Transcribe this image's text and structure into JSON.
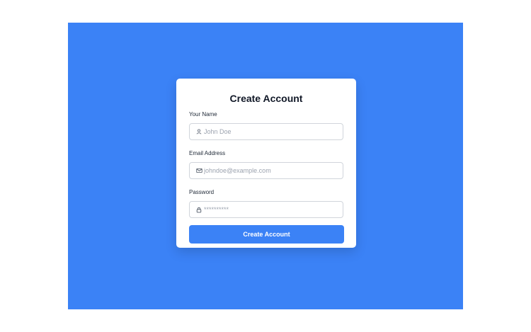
{
  "form": {
    "title": "Create Account",
    "fields": [
      {
        "label": "Your Name",
        "placeholder": "John Doe",
        "icon": "user-icon"
      },
      {
        "label": "Email Address",
        "placeholder": "johndoe@example.com",
        "icon": "mail-icon"
      },
      {
        "label": "Password",
        "placeholder": "**********",
        "icon": "lock-icon"
      }
    ],
    "submit_label": "Create Account"
  },
  "colors": {
    "backdrop": "#3b82f6",
    "button": "#3b82f6",
    "card": "#ffffff",
    "input_border": "#d1d5db"
  }
}
